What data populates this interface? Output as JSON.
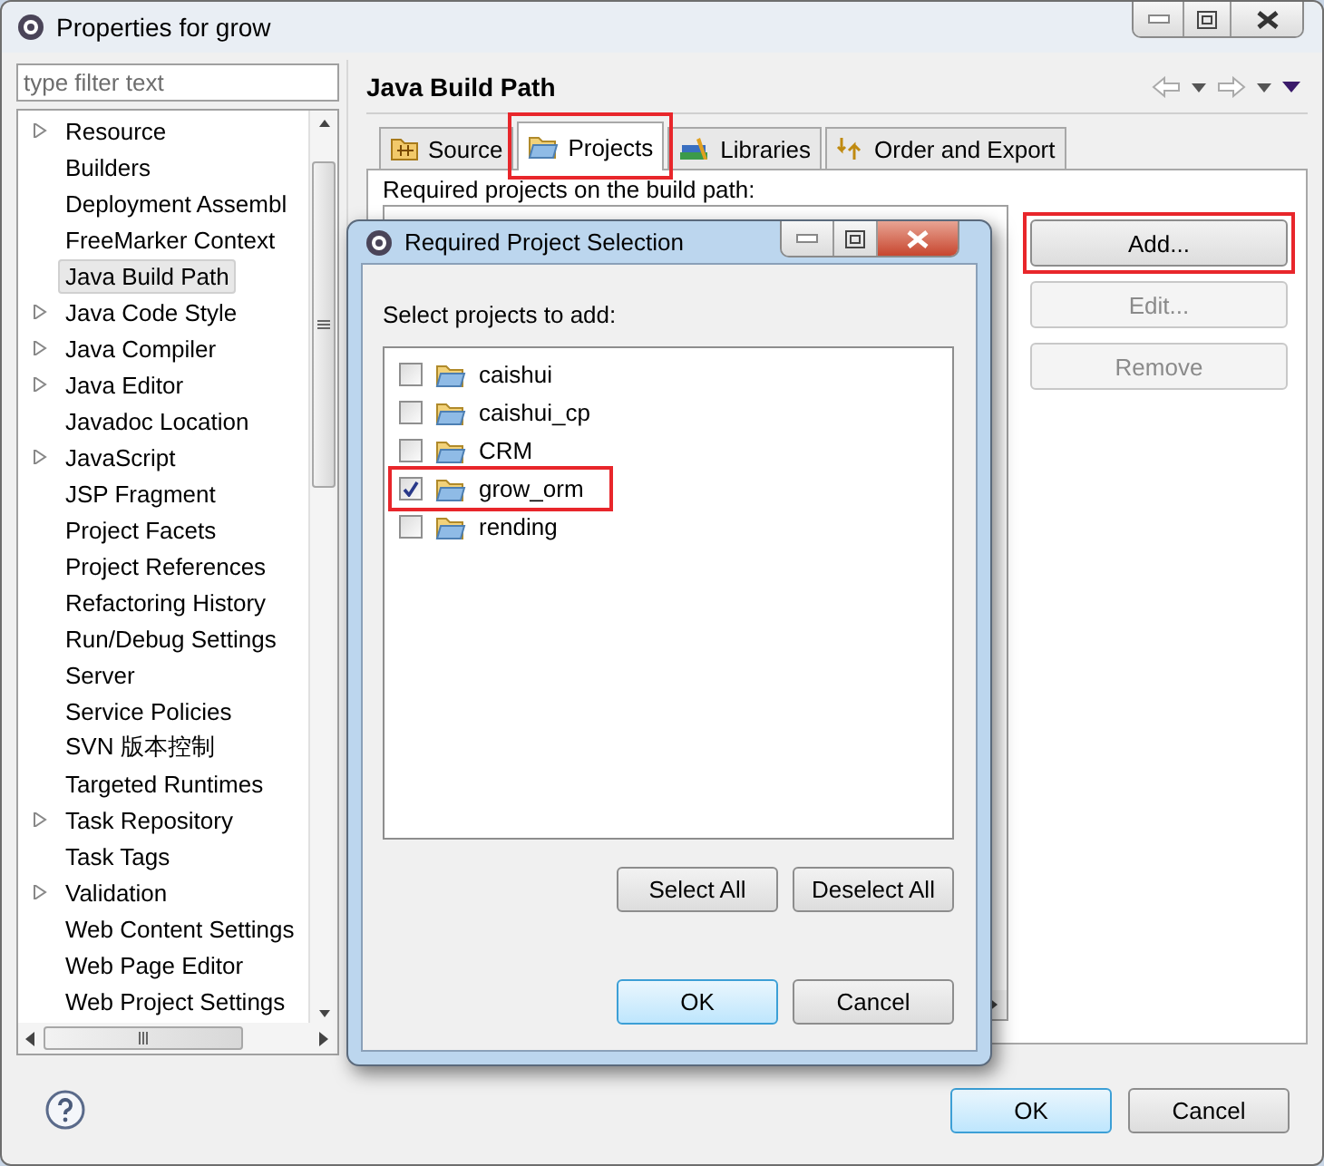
{
  "window": {
    "title": "Properties for grow"
  },
  "filter": {
    "placeholder": "type filter text"
  },
  "sidebar": {
    "items": [
      {
        "label": "Resource",
        "expandable": true,
        "selected": false
      },
      {
        "label": "Builders",
        "expandable": false,
        "selected": false
      },
      {
        "label": "Deployment Assembl",
        "expandable": false,
        "selected": false
      },
      {
        "label": "FreeMarker Context",
        "expandable": false,
        "selected": false
      },
      {
        "label": "Java Build Path",
        "expandable": false,
        "selected": true
      },
      {
        "label": "Java Code Style",
        "expandable": true,
        "selected": false
      },
      {
        "label": "Java Compiler",
        "expandable": true,
        "selected": false
      },
      {
        "label": "Java Editor",
        "expandable": true,
        "selected": false
      },
      {
        "label": "Javadoc Location",
        "expandable": false,
        "selected": false
      },
      {
        "label": "JavaScript",
        "expandable": true,
        "selected": false
      },
      {
        "label": "JSP Fragment",
        "expandable": false,
        "selected": false
      },
      {
        "label": "Project Facets",
        "expandable": false,
        "selected": false
      },
      {
        "label": "Project References",
        "expandable": false,
        "selected": false
      },
      {
        "label": "Refactoring History",
        "expandable": false,
        "selected": false
      },
      {
        "label": "Run/Debug Settings",
        "expandable": false,
        "selected": false
      },
      {
        "label": "Server",
        "expandable": false,
        "selected": false
      },
      {
        "label": "Service Policies",
        "expandable": false,
        "selected": false
      },
      {
        "label": "SVN 版本控制",
        "expandable": false,
        "selected": false
      },
      {
        "label": "Targeted Runtimes",
        "expandable": false,
        "selected": false
      },
      {
        "label": "Task Repository",
        "expandable": true,
        "selected": false
      },
      {
        "label": "Task Tags",
        "expandable": false,
        "selected": false
      },
      {
        "label": "Validation",
        "expandable": true,
        "selected": false
      },
      {
        "label": "Web Content Settings",
        "expandable": false,
        "selected": false
      },
      {
        "label": "Web Page Editor",
        "expandable": false,
        "selected": false
      },
      {
        "label": "Web Project Settings",
        "expandable": false,
        "selected": false
      }
    ]
  },
  "page": {
    "title": "Java Build Path",
    "tabs": [
      {
        "label": "Source",
        "kind": "source",
        "selected": false,
        "highlighted": false
      },
      {
        "label": "Projects",
        "kind": "folder",
        "selected": true,
        "highlighted": true
      },
      {
        "label": "Libraries",
        "kind": "books",
        "selected": false,
        "highlighted": false
      },
      {
        "label": "Order and Export",
        "kind": "order",
        "selected": false,
        "highlighted": false
      }
    ],
    "list_label": "Required projects on the build path:",
    "buttons": [
      {
        "label": "Add...",
        "disabled": false,
        "highlighted": true
      },
      {
        "label": "Edit...",
        "disabled": true,
        "highlighted": false
      },
      {
        "label": "Remove",
        "disabled": true,
        "highlighted": false
      }
    ]
  },
  "footer": {
    "buttons": [
      {
        "label": "OK",
        "default": true
      },
      {
        "label": "Cancel",
        "default": false
      }
    ]
  },
  "dialog": {
    "title": "Required Project Selection",
    "prompt": "Select projects to add:",
    "projects": [
      {
        "name": "caishui",
        "checked": false,
        "highlighted": false
      },
      {
        "name": "caishui_cp",
        "checked": false,
        "highlighted": false
      },
      {
        "name": "CRM",
        "checked": false,
        "highlighted": false
      },
      {
        "name": "grow_orm",
        "checked": true,
        "highlighted": true
      },
      {
        "name": "rending",
        "checked": false,
        "highlighted": false
      }
    ],
    "list_buttons": [
      "Select All",
      "Deselect All"
    ],
    "buttons": [
      {
        "label": "OK",
        "default": true
      },
      {
        "label": "Cancel",
        "default": false
      }
    ]
  }
}
